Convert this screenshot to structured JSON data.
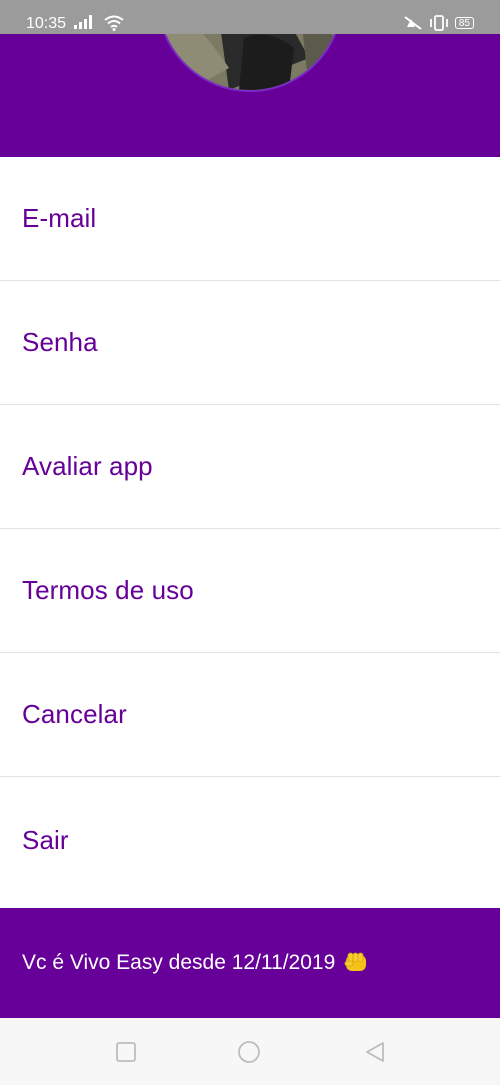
{
  "status_bar": {
    "time": "10:35",
    "battery": "85",
    "icons": [
      "signal-icon",
      "wifi-icon",
      "vibrate-off-icon",
      "vibrate-icon",
      "battery-icon"
    ]
  },
  "colors": {
    "brand_purple": "#660099",
    "divider": "#e2e2e2",
    "status_bar": "#9b9b9b"
  },
  "menu": {
    "items": [
      {
        "label": "E-mail"
      },
      {
        "label": "Senha"
      },
      {
        "label": "Avaliar app"
      },
      {
        "label": "Termos de uso"
      },
      {
        "label": "Cancelar"
      },
      {
        "label": "Sair"
      }
    ]
  },
  "footer": {
    "text": "Vc é Vivo Easy desde 12/11/2019",
    "emoji_icon": "fist-icon"
  },
  "nav_bar": {
    "icons": [
      "recents-square-icon",
      "home-circle-icon",
      "back-triangle-icon"
    ]
  }
}
